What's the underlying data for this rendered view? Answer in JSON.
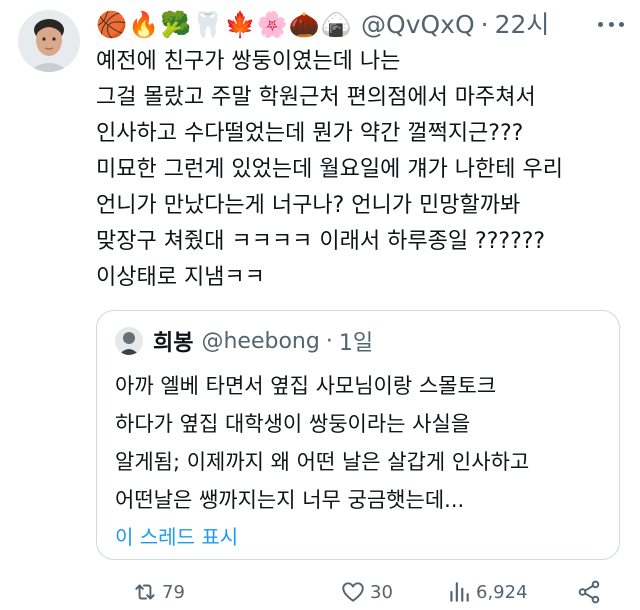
{
  "author": {
    "name_emoji": "🏀🔥🥦🦷🍁🌸🌰🍙",
    "handle": "@QvQxQ",
    "time": "22시"
  },
  "tweet_lines": [
    "예전에 친구가 쌍둥이였는데 나는",
    "그걸 몰랐고 주말 학원근처 편의점에서 마주쳐서",
    "인사하고 수다떨었는데 뭔가 약간 껄쩍지근???",
    "미묘한 그런게 있었는데 월요일에 걔가 나한테 우리",
    "언니가 만났다는게 너구나? 언니가 민망할까봐",
    "맞장구 쳐줬대 ㅋㅋㅋㅋ 이래서 하루종일 ??????",
    "이상태로 지냄ㅋㅋ"
  ],
  "quote": {
    "name": "희봉",
    "handle": "@heebong",
    "time": "1일",
    "lines": [
      "아까 엘베 타면서 옆집 사모님이랑 스몰토크",
      "하다가 옆집 대학생이 쌍둥이라는 사실을",
      "알게됨; 이제까지 왜 어떤 날은 살갑게 인사하고",
      "어떤날은 쌩까지는지 너무 궁금햇는데..."
    ],
    "show_thread": "이 스레드 표시"
  },
  "actions": {
    "retweets": "79",
    "likes": "30",
    "views": "6,924"
  },
  "colors": {
    "secondary_text": "#536471",
    "link": "#1d9bf0",
    "border": "#cfd9de"
  }
}
